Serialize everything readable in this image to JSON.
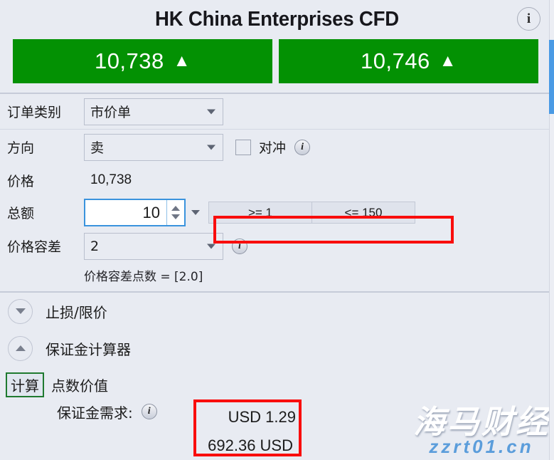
{
  "header": {
    "title": "HK China Enterprises CFD",
    "info_icon": "info-icon",
    "bid": {
      "value": "10,738",
      "arrow": "▲"
    },
    "ask": {
      "value": "10,746",
      "arrow": "▲"
    }
  },
  "form": {
    "order_type": {
      "label": "订单类别",
      "value": "市价单"
    },
    "direction": {
      "label": "方向",
      "value": "卖"
    },
    "hedge": {
      "label": "对冲",
      "checked": false
    },
    "price": {
      "label": "价格",
      "value": "10,738"
    },
    "quantity": {
      "label": "总额",
      "value": "10",
      "min_hint": ">= 1",
      "max_hint": "<= 150"
    },
    "tolerance": {
      "label": "价格容差",
      "value": "2",
      "hint": "价格容差点数 = [2.0]"
    }
  },
  "sections": {
    "stop_limit": {
      "title": "止损/限价",
      "expanded": false,
      "chevron": "chevron-down-icon"
    },
    "margin_calculator": {
      "title": "保证金计算器",
      "expanded": true,
      "chevron": "chevron-up-icon"
    }
  },
  "margin": {
    "calc_button": "计算",
    "point_value_label": "点数价值",
    "point_value": "USD 1.29",
    "margin_required_label": "保证金需求:",
    "margin_required": "692.36 USD"
  },
  "watermark": {
    "brand": "海马财经",
    "url": "zzrt01.cn"
  },
  "colors": {
    "background": "#e8ebf2",
    "price_green": "#039103",
    "highlight_red": "#f90d0d",
    "calc_green": "#1f7a30",
    "focus_blue": "#3a93dd",
    "scrollbar_blue": "#4a9ae4"
  }
}
